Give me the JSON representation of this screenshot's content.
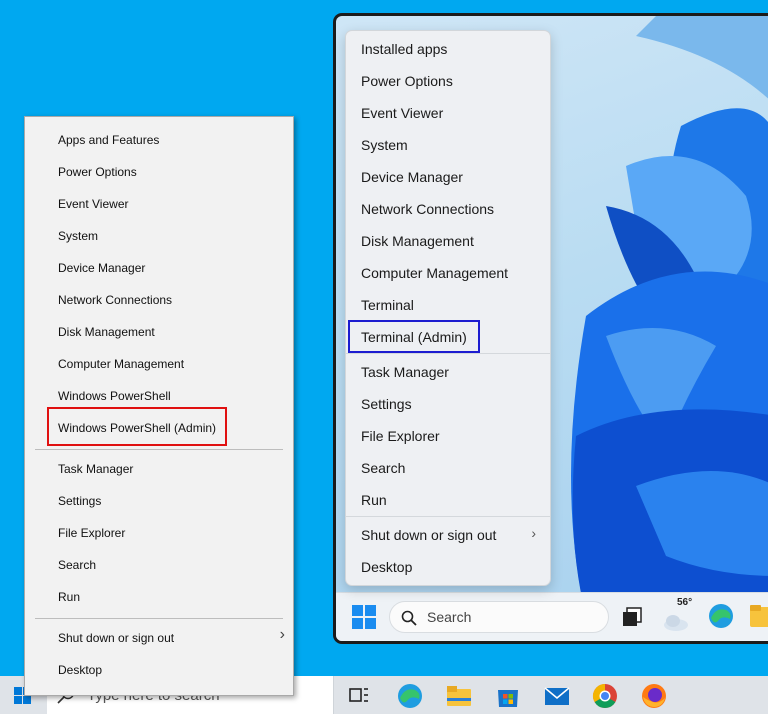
{
  "win10_menu": {
    "items": [
      "Apps and Features",
      "Power Options",
      "Event Viewer",
      "System",
      "Device Manager",
      "Network Connections",
      "Disk Management",
      "Computer Management",
      "Windows PowerShell",
      "Windows PowerShell (Admin)",
      "Task Manager",
      "Settings",
      "File Explorer",
      "Search",
      "Run",
      "Shut down or sign out",
      "Desktop"
    ],
    "highlighted_item": "Windows PowerShell (Admin)",
    "highlight_color": "#e01010",
    "submenu_arrow": "›"
  },
  "win11_menu": {
    "items": [
      "Installed apps",
      "Power Options",
      "Event Viewer",
      "System",
      "Device Manager",
      "Network Connections",
      "Disk Management",
      "Computer Management",
      "Terminal",
      "Terminal (Admin)",
      "Task Manager",
      "Settings",
      "File Explorer",
      "Search",
      "Run",
      "Shut down or sign out",
      "Desktop"
    ],
    "highlighted_item": "Terminal (Admin)",
    "highlight_color": "#1c1cd0",
    "submenu_arrow": "›"
  },
  "win10_taskbar": {
    "search_placeholder": "Type here to search",
    "icons": [
      "windows-start-icon",
      "task-view-icon",
      "edge-icon",
      "file-explorer-icon",
      "store-icon",
      "mail-icon",
      "chrome-icon",
      "firefox-icon"
    ]
  },
  "win11_taskbar": {
    "search_label": "Search",
    "weather_temp": "56°",
    "icons": [
      "windows-start-icon",
      "search-icon",
      "task-view-icon",
      "weather-icon",
      "edge-icon",
      "file-explorer-icon"
    ]
  },
  "colors": {
    "desktop_bg": "#00a8f0",
    "win11_accent": "#0a5fdc"
  }
}
